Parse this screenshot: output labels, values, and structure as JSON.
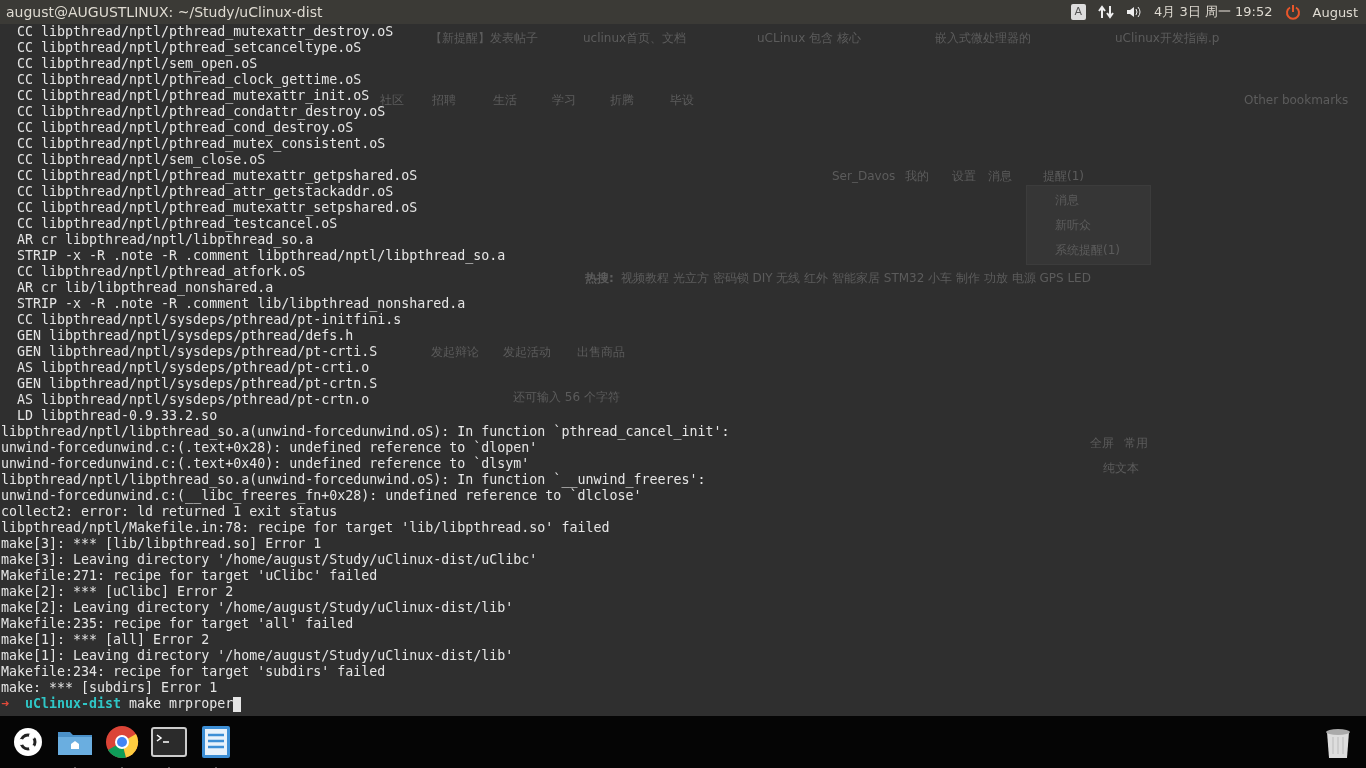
{
  "top_bar": {
    "title": "august@AUGUSTLINUX: ~/Study/uClinux-dist",
    "keyboard": "A",
    "clock": "4月 3日 周一 19:52",
    "user": "August"
  },
  "browser": {
    "tabs": [
      "【新提醒】发表帖子",
      "uclinux首页、文档",
      "uCLinux 包含 核心",
      "嵌入式微处理器的",
      "uClinux开发指南.p"
    ],
    "bookmarks": [
      "社区",
      "招聘",
      "生活",
      "学习",
      "折腾",
      "毕设"
    ],
    "other_bookmarks": "Other bookmarks",
    "user_links": [
      "Ser_Davos",
      "我的",
      "设置",
      "消息",
      "提醒(1)"
    ],
    "reminder_menu": [
      "消息",
      "新听众",
      "系统提醒(1)"
    ],
    "hot_label": "热搜:",
    "hot_words": "视频教程  光立方  密码锁  DIY  无线  红外  智能家居  STM32  小车  制作  功放  电源  GPS  LED",
    "post_tabs": [
      "发起辩论",
      "发起活动",
      "出售商品"
    ],
    "char_count": "还可输入 56 个字符",
    "editor_links": [
      "全屏",
      "常用",
      "纯文本"
    ]
  },
  "terminal": {
    "lines": [
      {
        "kind": "build",
        "text": "CC libpthread/nptl/pthread_mutexattr_destroy.oS"
      },
      {
        "kind": "build",
        "text": "CC libpthread/nptl/pthread_setcanceltype.oS"
      },
      {
        "kind": "build",
        "text": "CC libpthread/nptl/sem_open.oS"
      },
      {
        "kind": "build",
        "text": "CC libpthread/nptl/pthread_clock_gettime.oS"
      },
      {
        "kind": "build",
        "text": "CC libpthread/nptl/pthread_mutexattr_init.oS"
      },
      {
        "kind": "build",
        "text": "CC libpthread/nptl/pthread_condattr_destroy.oS"
      },
      {
        "kind": "build",
        "text": "CC libpthread/nptl/pthread_cond_destroy.oS"
      },
      {
        "kind": "build",
        "text": "CC libpthread/nptl/pthread_mutex_consistent.oS"
      },
      {
        "kind": "build",
        "text": "CC libpthread/nptl/sem_close.oS"
      },
      {
        "kind": "build",
        "text": "CC libpthread/nptl/pthread_mutexattr_getpshared.oS"
      },
      {
        "kind": "build",
        "text": "CC libpthread/nptl/pthread_attr_getstackaddr.oS"
      },
      {
        "kind": "build",
        "text": "CC libpthread/nptl/pthread_mutexattr_setpshared.oS"
      },
      {
        "kind": "build",
        "text": "CC libpthread/nptl/pthread_testcancel.oS"
      },
      {
        "kind": "build",
        "text": "AR cr libpthread/nptl/libpthread_so.a"
      },
      {
        "kind": "build",
        "text": "STRIP -x -R .note -R .comment libpthread/nptl/libpthread_so.a"
      },
      {
        "kind": "build",
        "text": "CC libpthread/nptl/pthread_atfork.oS"
      },
      {
        "kind": "build",
        "text": "AR cr lib/libpthread_nonshared.a"
      },
      {
        "kind": "build",
        "text": "STRIP -x -R .note -R .comment lib/libpthread_nonshared.a"
      },
      {
        "kind": "build",
        "text": "CC libpthread/nptl/sysdeps/pthread/pt-initfini.s"
      },
      {
        "kind": "build",
        "text": "GEN libpthread/nptl/sysdeps/pthread/defs.h"
      },
      {
        "kind": "build",
        "text": "GEN libpthread/nptl/sysdeps/pthread/pt-crti.S"
      },
      {
        "kind": "build",
        "text": "AS libpthread/nptl/sysdeps/pthread/pt-crti.o"
      },
      {
        "kind": "build",
        "text": "GEN libpthread/nptl/sysdeps/pthread/pt-crtn.S"
      },
      {
        "kind": "build",
        "text": "AS libpthread/nptl/sysdeps/pthread/pt-crtn.o"
      },
      {
        "kind": "build",
        "text": "LD libpthread-0.9.33.2.so"
      },
      {
        "kind": "plain",
        "text": "libpthread/nptl/libpthread_so.a(unwind-forcedunwind.oS): In function `pthread_cancel_init':"
      },
      {
        "kind": "plain",
        "text": "unwind-forcedunwind.c:(.text+0x28): undefined reference to `dlopen'"
      },
      {
        "kind": "plain",
        "text": "unwind-forcedunwind.c:(.text+0x40): undefined reference to `dlsym'"
      },
      {
        "kind": "plain",
        "text": "libpthread/nptl/libpthread_so.a(unwind-forcedunwind.oS): In function `__unwind_freeres':"
      },
      {
        "kind": "plain",
        "text": "unwind-forcedunwind.c:(__libc_freeres_fn+0x28): undefined reference to `dlclose'"
      },
      {
        "kind": "plain",
        "text": "collect2: error: ld returned 1 exit status"
      },
      {
        "kind": "plain",
        "text": "libpthread/nptl/Makefile.in:78: recipe for target 'lib/libpthread.so' failed"
      },
      {
        "kind": "plain",
        "text": "make[3]: *** [lib/libpthread.so] Error 1"
      },
      {
        "kind": "plain",
        "text": "make[3]: Leaving directory '/home/august/Study/uClinux-dist/uClibc'"
      },
      {
        "kind": "plain",
        "text": "Makefile:271: recipe for target 'uClibc' failed"
      },
      {
        "kind": "plain",
        "text": "make[2]: *** [uClibc] Error 2"
      },
      {
        "kind": "plain",
        "text": "make[2]: Leaving directory '/home/august/Study/uClinux-dist/lib'"
      },
      {
        "kind": "plain",
        "text": "Makefile:235: recipe for target 'all' failed"
      },
      {
        "kind": "plain",
        "text": "make[1]: *** [all] Error 2"
      },
      {
        "kind": "plain",
        "text": "make[1]: Leaving directory '/home/august/Study/uClinux-dist/lib'"
      },
      {
        "kind": "plain",
        "text": "Makefile:234: recipe for target 'subdirs' failed"
      },
      {
        "kind": "plain",
        "text": "make: *** [subdirs] Error 1"
      }
    ],
    "prompt": {
      "arrow": "➜",
      "directory": "uClinux-dist",
      "command": "make mrproper"
    }
  }
}
